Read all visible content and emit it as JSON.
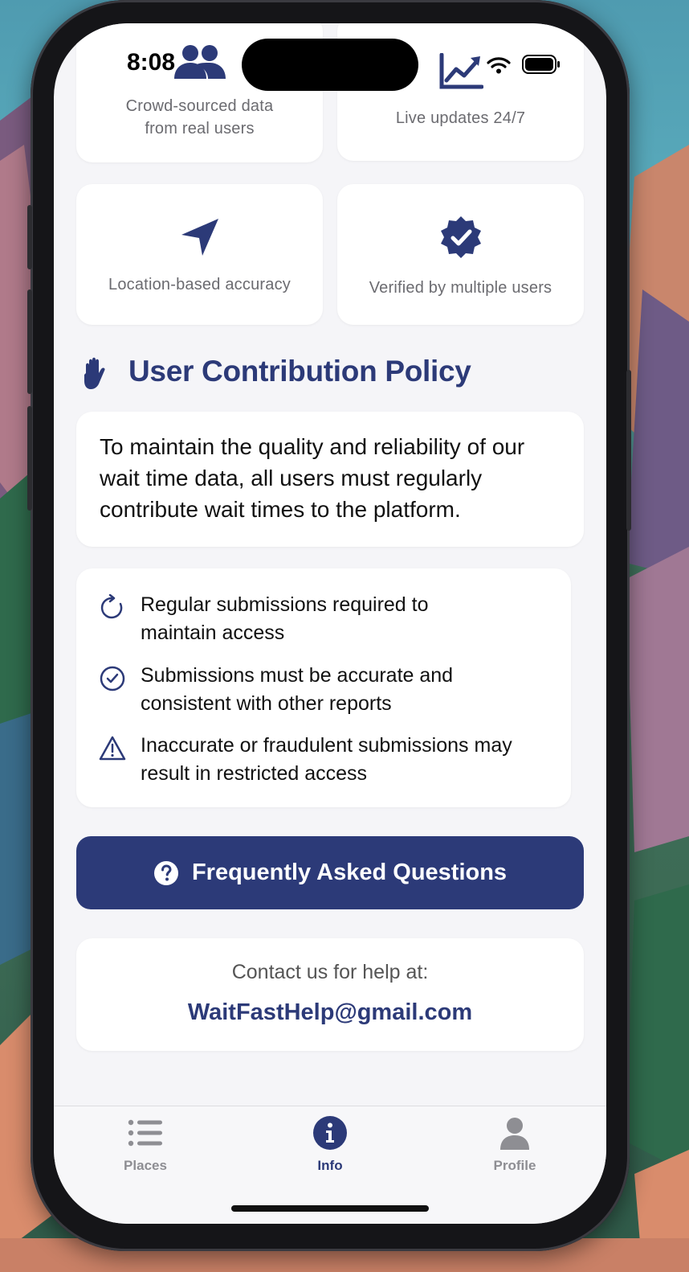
{
  "status_bar": {
    "time": "8:08"
  },
  "features": [
    {
      "icon": "users-icon",
      "text_line1": "Crowd-sourced data",
      "text_line2": "from real users"
    },
    {
      "icon": "chart-line-icon",
      "text": "Live updates 24/7"
    },
    {
      "icon": "location-arrow-icon",
      "text": "Location-based accuracy"
    },
    {
      "icon": "verified-badge-icon",
      "text": "Verified by multiple users"
    }
  ],
  "policy": {
    "title": "User Contribution Policy",
    "title_icon": "hand-icon",
    "description": "To maintain the quality and reliability of our wait time data, all users must regularly contribute wait times to the platform.",
    "rules": [
      {
        "icon": "refresh-icon",
        "line1": "Regular submissions required to",
        "line2": "maintain access"
      },
      {
        "icon": "check-circle-icon",
        "line1": "Submissions must be accurate and",
        "line2": "consistent with other reports"
      },
      {
        "icon": "warning-icon",
        "line1": "Inaccurate or fraudulent submissions may",
        "line2": "result in restricted access"
      }
    ]
  },
  "faq_button": {
    "label": "Frequently Asked Questions",
    "icon": "question-circle-icon"
  },
  "contact": {
    "label": "Contact us for help at:",
    "email": "WaitFastHelp@gmail.com"
  },
  "tab_bar": {
    "tabs": [
      {
        "label": "Places",
        "icon": "list-icon",
        "active": false
      },
      {
        "label": "Info",
        "icon": "info-circle-icon",
        "active": true
      },
      {
        "label": "Profile",
        "icon": "person-icon",
        "active": false
      }
    ]
  },
  "colors": {
    "accent": "#2c3a78",
    "inactive": "#8e8e93",
    "background": "#f5f5f8"
  }
}
